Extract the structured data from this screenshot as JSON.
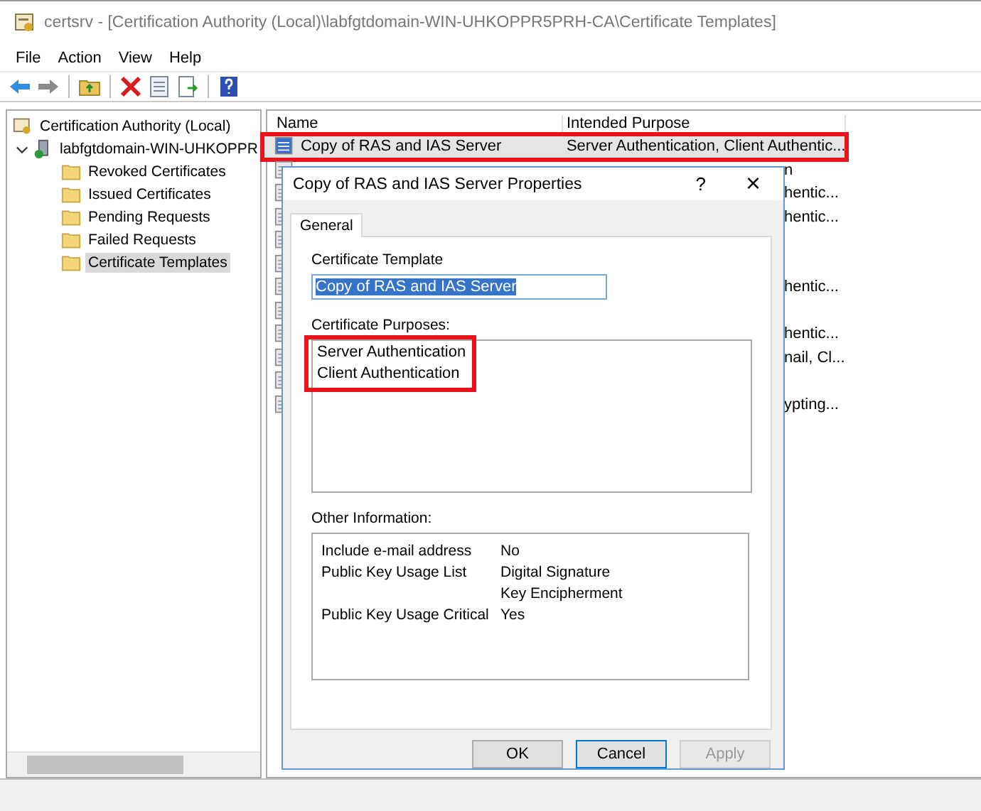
{
  "window": {
    "title": "certsrv - [Certification Authority (Local)\\labfgtdomain-WIN-UHKOPPR5PRH-CA\\Certificate Templates]"
  },
  "menu": [
    "File",
    "Action",
    "View",
    "Help"
  ],
  "tree": {
    "label": "Certification Authority (Local)",
    "children": [
      {
        "label": "labfgtdomain-WIN-UHKOPPR",
        "expanded": true,
        "children": [
          {
            "label": "Revoked Certificates",
            "selected": false
          },
          {
            "label": "Issued Certificates",
            "selected": false
          },
          {
            "label": "Pending Requests",
            "selected": false
          },
          {
            "label": "Failed Requests",
            "selected": false
          },
          {
            "label": "Certificate Templates",
            "selected": true
          }
        ]
      }
    ]
  },
  "table": {
    "columns": [
      "Name",
      "Intended Purpose"
    ],
    "rows": [
      {
        "name": "Copy of RAS and IAS Server",
        "purpose": "Server Authentication, Client Authentic...",
        "selected": true,
        "highlighted": true
      },
      {
        "purpose": "n",
        "selected": false,
        "highlighted": false
      },
      {
        "purpose": "hentic...",
        "selected": false,
        "highlighted": false
      },
      {
        "purpose": "hentic...",
        "selected": false,
        "highlighted": false
      },
      {
        "selected": false,
        "highlighted": false
      },
      {
        "selected": false,
        "highlighted": false
      },
      {
        "purpose": "hentic...",
        "selected": false,
        "highlighted": false
      },
      {
        "selected": false,
        "highlighted": false
      },
      {
        "purpose": "hentic...",
        "selected": false,
        "highlighted": false
      },
      {
        "purpose": "nail, Cl...",
        "selected": false,
        "highlighted": false
      },
      {
        "selected": false,
        "highlighted": false
      },
      {
        "purpose": "ypting...",
        "selected": false,
        "highlighted": false
      }
    ]
  },
  "dialog": {
    "title": "Copy of RAS and IAS Server Properties",
    "help": "?",
    "close": "×",
    "tabs": [
      {
        "label": "General",
        "selected": true
      }
    ],
    "template_label": "Certificate Template",
    "template_value": "Copy of RAS and IAS Server",
    "purposes_label": "Certificate Purposes:",
    "purposes": [
      "Server Authentication",
      "Client Authentication"
    ],
    "purposes_highlighted": true,
    "info_label": "Other Information:",
    "info": [
      {
        "key": "Include e-mail address",
        "values": [
          "No"
        ]
      },
      {
        "key": "Public Key Usage List",
        "values": [
          "Digital Signature",
          "Key Encipherment"
        ]
      },
      {
        "key": "Public Key Usage Critical",
        "values": [
          "Yes"
        ]
      }
    ],
    "buttons": [
      {
        "label": "OK",
        "disabled": false,
        "default": false
      },
      {
        "label": "Cancel",
        "disabled": false,
        "default": true
      },
      {
        "label": "Apply",
        "disabled": true,
        "default": false
      }
    ]
  }
}
